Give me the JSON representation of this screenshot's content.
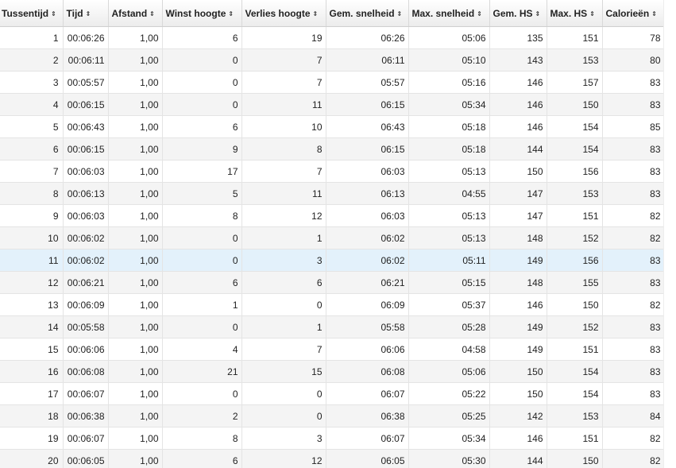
{
  "columns": [
    "Tussentijd",
    "Tijd",
    "Afstand",
    "Winst hoogte",
    "Verlies hoogte",
    "Gem. snelheid",
    "Max. snelheid",
    "Gem. HS",
    "Max. HS",
    "Calorieën"
  ],
  "sort_icon": "sort-icon",
  "selected_row": 11,
  "rows": [
    [
      "1",
      "00:06:26",
      "1,00",
      "6",
      "19",
      "06:26",
      "05:06",
      "135",
      "151",
      "78"
    ],
    [
      "2",
      "00:06:11",
      "1,00",
      "0",
      "7",
      "06:11",
      "05:10",
      "143",
      "153",
      "80"
    ],
    [
      "3",
      "00:05:57",
      "1,00",
      "0",
      "7",
      "05:57",
      "05:16",
      "146",
      "157",
      "83"
    ],
    [
      "4",
      "00:06:15",
      "1,00",
      "0",
      "11",
      "06:15",
      "05:34",
      "146",
      "150",
      "83"
    ],
    [
      "5",
      "00:06:43",
      "1,00",
      "6",
      "10",
      "06:43",
      "05:18",
      "146",
      "154",
      "85"
    ],
    [
      "6",
      "00:06:15",
      "1,00",
      "9",
      "8",
      "06:15",
      "05:18",
      "144",
      "154",
      "83"
    ],
    [
      "7",
      "00:06:03",
      "1,00",
      "17",
      "7",
      "06:03",
      "05:13",
      "150",
      "156",
      "83"
    ],
    [
      "8",
      "00:06:13",
      "1,00",
      "5",
      "11",
      "06:13",
      "04:55",
      "147",
      "153",
      "83"
    ],
    [
      "9",
      "00:06:03",
      "1,00",
      "8",
      "12",
      "06:03",
      "05:13",
      "147",
      "151",
      "82"
    ],
    [
      "10",
      "00:06:02",
      "1,00",
      "0",
      "1",
      "06:02",
      "05:13",
      "148",
      "152",
      "82"
    ],
    [
      "11",
      "00:06:02",
      "1,00",
      "0",
      "3",
      "06:02",
      "05:11",
      "149",
      "156",
      "83"
    ],
    [
      "12",
      "00:06:21",
      "1,00",
      "6",
      "6",
      "06:21",
      "05:15",
      "148",
      "155",
      "83"
    ],
    [
      "13",
      "00:06:09",
      "1,00",
      "1",
      "0",
      "06:09",
      "05:37",
      "146",
      "150",
      "82"
    ],
    [
      "14",
      "00:05:58",
      "1,00",
      "0",
      "1",
      "05:58",
      "05:28",
      "149",
      "152",
      "83"
    ],
    [
      "15",
      "00:06:06",
      "1,00",
      "4",
      "7",
      "06:06",
      "04:58",
      "149",
      "151",
      "83"
    ],
    [
      "16",
      "00:06:08",
      "1,00",
      "21",
      "15",
      "06:08",
      "05:06",
      "150",
      "154",
      "83"
    ],
    [
      "17",
      "00:06:07",
      "1,00",
      "0",
      "0",
      "06:07",
      "05:22",
      "150",
      "154",
      "83"
    ],
    [
      "18",
      "00:06:38",
      "1,00",
      "2",
      "0",
      "06:38",
      "05:25",
      "142",
      "153",
      "84"
    ],
    [
      "19",
      "00:06:07",
      "1,00",
      "8",
      "3",
      "06:07",
      "05:34",
      "146",
      "151",
      "82"
    ],
    [
      "20",
      "00:06:05",
      "1,00",
      "6",
      "12",
      "06:05",
      "05:30",
      "144",
      "150",
      "82"
    ]
  ],
  "colors": {
    "row_even": "#f4f4f4",
    "row_selected": "#e3f1fb",
    "grid_line": "#e4e4e4"
  }
}
